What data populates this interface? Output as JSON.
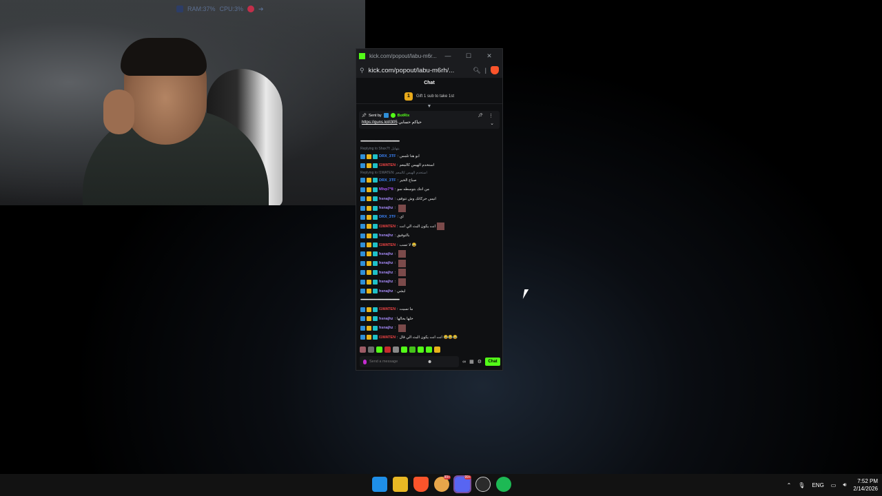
{
  "sysmon": {
    "ram": "RAM:37%",
    "cpu": "CPU:3%"
  },
  "popup": {
    "window_title": "kick.com/popout/labu-m6r...",
    "url": "kick.com/popout/labu-m6rh/...",
    "chat_header": "Chat",
    "gift_count": "1",
    "gift_text": "Gift 1 sub to take 1st",
    "pinned": {
      "sent_by": "Sent by",
      "bot_name": "BotRix",
      "message_prefix": "حياكم حسابي",
      "link": "https://guns.lol/i305"
    },
    "messages": [
      {
        "type": "sep",
        "text": "•••••••••••••••••••••••••••••••••••••••••••••••••••"
      },
      {
        "type": "reply",
        "text": "Replying to Shax7f: يتهايل"
      },
      {
        "type": "msg",
        "user": "DRX_3TF",
        "color": "#3b82f6",
        "text": "ابو هنا تلمس"
      },
      {
        "type": "msg",
        "user": "I1WATEN",
        "color": "#ef4444",
        "text": "استخدم الهيس كالمعم"
      },
      {
        "type": "reply",
        "text": "Replying to I1WATEN: استخدم الهيس كالمعم"
      },
      {
        "type": "msg",
        "user": "DRX_3TF",
        "color": "#3b82f6",
        "text": "صباح الخير"
      },
      {
        "type": "msg",
        "user": "Mlvp7*8",
        "color": "#a855f7",
        "text": "من انتك بتوسطه سو"
      },
      {
        "type": "msg",
        "user": "hsnajhz",
        "color": "#a78bfa",
        "text": "انيس حركاتك وش تتوقف"
      },
      {
        "type": "msg",
        "user": "hsnajhz",
        "color": "#a78bfa",
        "text": "",
        "thumb": true
      },
      {
        "type": "msg",
        "user": "DRX_3TF",
        "color": "#3b82f6",
        "text": "اي"
      },
      {
        "type": "msg",
        "user": "I1WATEN",
        "color": "#ef4444",
        "text": "انت يكون البث الي انت",
        "thumb": true
      },
      {
        "type": "msg",
        "user": "hsnajhz",
        "color": "#a78bfa",
        "text": "بالتوفيق"
      },
      {
        "type": "msg",
        "user": "I1WATEN",
        "color": "#ef4444",
        "text": "لا تسب 😂"
      },
      {
        "type": "msg",
        "user": "hsnajhz",
        "color": "#a78bfa",
        "text": "",
        "thumb": true
      },
      {
        "type": "msg",
        "user": "hsnajhz",
        "color": "#a78bfa",
        "text": "",
        "thumb": true
      },
      {
        "type": "msg",
        "user": "hsnajhz",
        "color": "#a78bfa",
        "text": "",
        "thumb": true
      },
      {
        "type": "msg",
        "user": "hsnajhz",
        "color": "#a78bfa",
        "text": "",
        "thumb": true
      },
      {
        "type": "msg",
        "user": "hsnajhz",
        "color": "#a78bfa",
        "text": "ايشي"
      },
      {
        "type": "sep",
        "text": "•••••••••••••••••••••••••••••••••••••••••••••••••••"
      },
      {
        "type": "msg",
        "user": "I1WATEN",
        "color": "#ef4444",
        "text": "ما نسيت"
      },
      {
        "type": "msg",
        "user": "hsnajhz",
        "color": "#a78bfa",
        "text": "خلها بحالها"
      },
      {
        "type": "msg",
        "user": "hsnajhz",
        "color": "#a78bfa",
        "text": "",
        "thumb": true
      },
      {
        "type": "msg",
        "user": "I1WATEN",
        "color": "#ef4444",
        "text": "انت انت يكون البث الي قال 😂😂😂"
      }
    ],
    "composer_placeholder": "Send a message",
    "send_label": "Chat"
  },
  "taskbar": {
    "apps": [
      "start",
      "file-explorer",
      "brave",
      "app-99",
      "discord",
      "steam",
      "spotify"
    ],
    "badges": {
      "app-99": "99+",
      "discord": "99+"
    },
    "tray": {
      "lang": "ENG",
      "time": "7:52 PM",
      "date": "2/14/2026"
    }
  },
  "colors": {
    "kick_green": "#53fc18",
    "taskbar": "#121212"
  }
}
